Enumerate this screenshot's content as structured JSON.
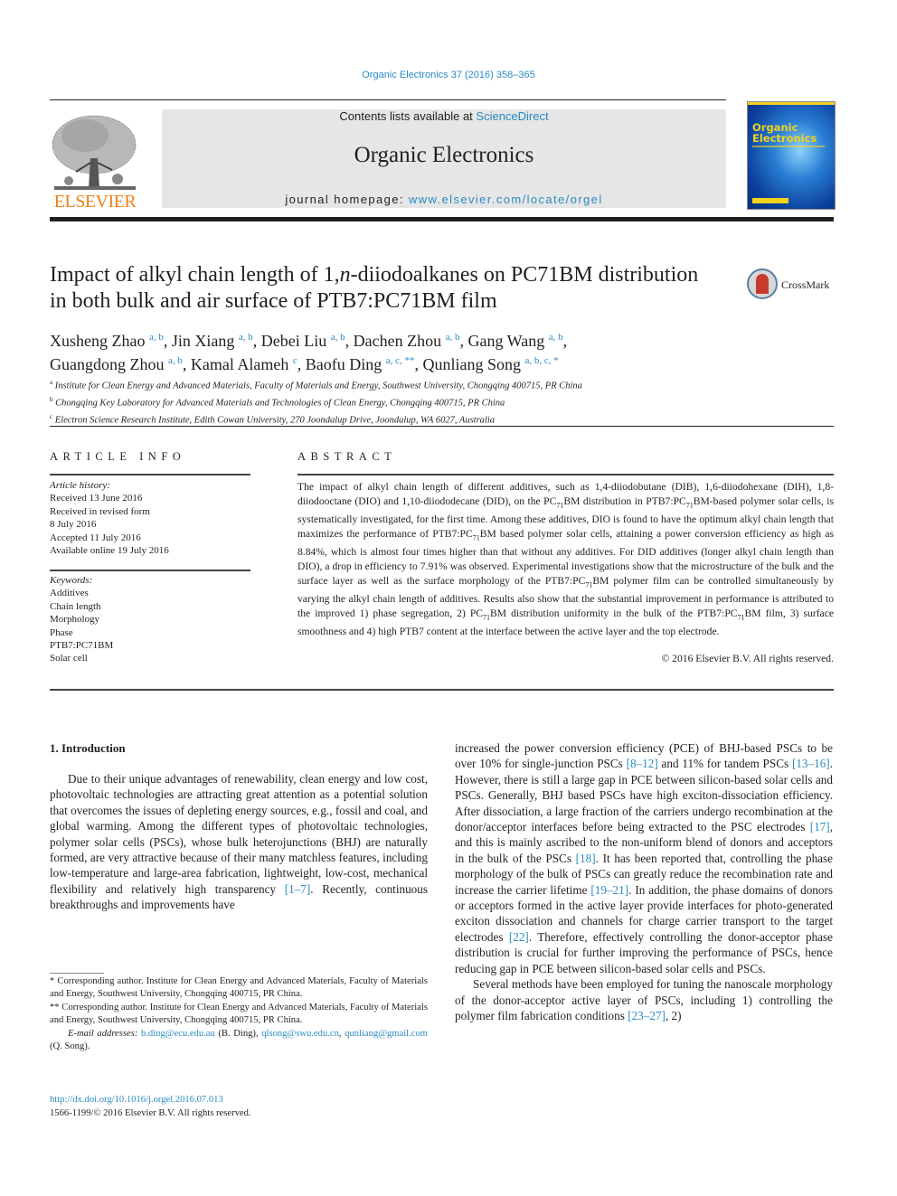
{
  "header": {
    "running_head": "Organic Electronics 37 (2016) 358–365",
    "contents_prefix": "Contents lists available at ",
    "contents_link": "ScienceDirect",
    "journal_name": "Organic Electronics",
    "homepage_prefix": "journal homepage: ",
    "homepage_link": "www.elsevier.com/locate/orgel",
    "publisher_logo_text": "ELSEVIER",
    "cover_title_line1": "Organic",
    "cover_title_line2": "Electronics",
    "crossmark_label": "CrossMark",
    "colors": {
      "link": "#2a8bc2",
      "elsevier_orange": "#f07f1a",
      "masthead_bg": "#e6e6e6",
      "cover_yellow": "#f2d21b"
    }
  },
  "article": {
    "title_part1": "Impact of alkyl chain length of 1,",
    "title_italic": "n",
    "title_part2": "-diiodoalkanes on PC71BM distribution in both bulk and air surface of PTB7:PC71BM film",
    "authors": [
      {
        "name": "Xusheng Zhao",
        "aff": "a, b"
      },
      {
        "name": "Jin Xiang",
        "aff": "a, b"
      },
      {
        "name": "Debei Liu",
        "aff": "a, b"
      },
      {
        "name": "Dachen Zhou",
        "aff": "a, b"
      },
      {
        "name": "Gang Wang",
        "aff": "a, b"
      },
      {
        "name": "Guangdong Zhou",
        "aff": "a, b"
      },
      {
        "name": "Kamal Alameh",
        "aff": "c"
      },
      {
        "name": "Baofu Ding",
        "aff": "a, c, **"
      },
      {
        "name": "Qunliang Song",
        "aff": "a, b, c, *"
      }
    ],
    "affiliations": [
      {
        "mark": "a",
        "text": "Institute for Clean Energy and Advanced Materials, Faculty of Materials and Energy, Southwest University, Chongqing 400715, PR China"
      },
      {
        "mark": "b",
        "text": "Chongqing Key Laboratory for Advanced Materials and Technologies of Clean Energy, Chongqing 400715, PR China"
      },
      {
        "mark": "c",
        "text": "Electron Science Research Institute, Edith Cowan University, 270 Joondalup Drive, Joondalup, WA 6027, Australia"
      }
    ]
  },
  "article_info": {
    "heading": "ARTICLE INFO",
    "history_label": "Article history:",
    "history": [
      "Received 13 June 2016",
      "Received in revised form",
      "8 July 2016",
      "Accepted 11 July 2016",
      "Available online 19 July 2016"
    ],
    "keywords_label": "Keywords:",
    "keywords": [
      "Additives",
      "Chain length",
      "Morphology",
      "Phase",
      "PTB7:PC71BM",
      "Solar cell"
    ]
  },
  "abstract": {
    "heading": "ABSTRACT",
    "segments": [
      "The impact of alkyl chain length of different additives, such as 1,4-diiodobutane (DIB), 1,6-diiodohexane (DIH), 1,8-diiodooctane (DIO) and 1,10-diiododecane (DID), on the PC",
      "71",
      "BM distribution in PTB7:PC",
      "71",
      "BM-based polymer solar cells, is systematically investigated, for the first time. Among these additives, DIO is found to have the optimum alkyl chain length that maximizes the performance of PTB7:PC",
      "71",
      "BM based polymer solar cells, attaining a power conversion efficiency as high as 8.84%, which is almost four times higher than that without any additives. For DID additives (longer alkyl chain length than DIO), a drop in efficiency to 7.91% was observed. Experimental investigations show that the microstructure of the bulk and the surface layer as well as the surface morphology of the PTB7:PC",
      "71",
      "BM polymer film can be controlled simultaneously by varying the alkyl chain length of additives. Results also show that the substantial improvement in performance is attributed to the improved 1) phase segregation, 2) PC",
      "71",
      "BM distribution uniformity in the bulk of the PTB7:PC",
      "71",
      "BM film, 3) surface smoothness and 4) high PTB7 content at the interface between the active layer and the top electrode."
    ],
    "copyright": "© 2016 Elsevier B.V. All rights reserved."
  },
  "body": {
    "intro_heading": "1.  Introduction",
    "left_para": [
      "Due to their unique advantages of renewability, clean energy and low cost, photovoltaic technologies are attracting great attention as a potential solution that overcomes the issues of depleting energy sources, e.g., fossil and coal, and global warming. Among the different types of photovoltaic technologies, polymer solar cells (PSCs), whose bulk heterojunctions (BHJ) are naturally formed, are very attractive because of their many matchless features, including low-temperature and large-area fabrication, lightweight, low-cost, mechanical flexibility and relatively high transparency ",
      "[1–7]",
      ". Recently, continuous breakthroughs and improvements have"
    ],
    "right_para1": [
      "increased the power conversion efficiency (PCE) of BHJ-based PSCs to be over 10% for single-junction PSCs ",
      "[8–12]",
      " and 11% for tandem PSCs ",
      "[13–16]",
      ". However, there is still a large gap in PCE between silicon-based solar cells and PSCs. Generally, BHJ based PSCs have high exciton-dissociation efficiency. After dissociation, a large fraction of the carriers undergo recombination at the donor/acceptor interfaces before being extracted to the PSC electrodes ",
      "[17]",
      ", and this is mainly ascribed to the non-uniform blend of donors and acceptors in the bulk of the PSCs ",
      "[18]",
      ". It has been reported that, controlling the phase morphology of the bulk of PSCs can greatly reduce the recombination rate and increase the carrier lifetime ",
      "[19–21]",
      ". In addition, the phase domains of donors or acceptors formed in the active layer provide interfaces for photo-generated exciton dissociation and channels for charge carrier transport to the target electrodes ",
      "[22]",
      ". Therefore, effectively controlling the donor-acceptor phase distribution is crucial for further improving the performance of PSCs, hence reducing gap in PCE between silicon-based solar cells and PSCs."
    ],
    "right_para2": [
      "Several methods have been employed for tuning the nanoscale morphology of the donor-acceptor active layer of PSCs, including 1) controlling the polymer film fabrication conditions ",
      "[23–27]",
      ", 2)"
    ]
  },
  "footnotes": {
    "fn1": " * Corresponding author. Institute for Clean Energy and Advanced Materials, Faculty of Materials and Energy, Southwest University, Chongqing 400715, PR China.",
    "fn2": " ** Corresponding author. Institute for Clean Energy and Advanced Materials, Faculty of Materials and Energy, Southwest University, Chongqing 400715, PR China.",
    "email_label": "E-mail addresses: ",
    "email1": "b.ding@ecu.edu.au",
    "email1_owner": " (B. Ding), ",
    "email2": "qlsong@swu.edu.cn",
    "sep": ", ",
    "email3": "qunliang@gmail.com",
    "email3_owner": " (Q. Song).",
    "doi": "http://dx.doi.org/10.1016/j.orgel.2016.07.013",
    "issn": "1566-1199/© 2016 Elsevier B.V. All rights reserved."
  }
}
